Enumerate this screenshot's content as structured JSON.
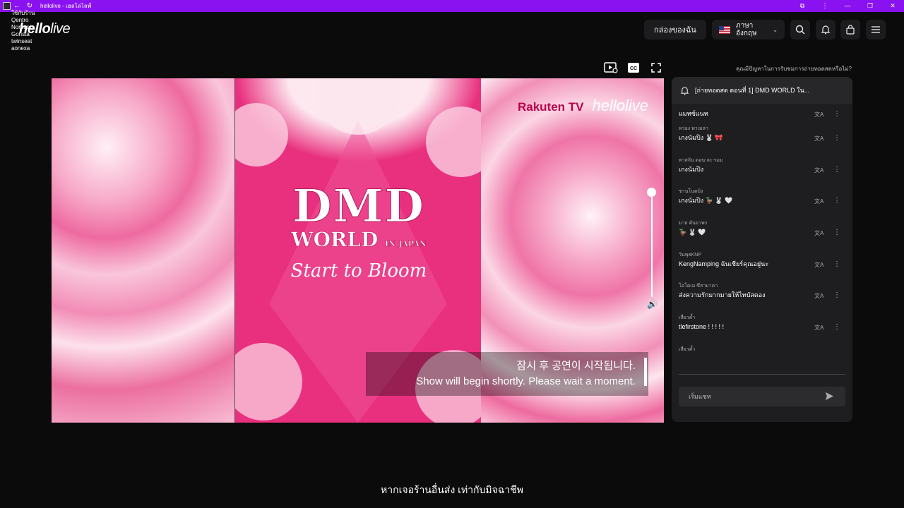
{
  "window": {
    "title": "hellolive - เฮลโลไลฟ์",
    "controls": [
      "←",
      "↻"
    ],
    "right_controls": [
      "⧉",
      "⋮",
      "—",
      "❐",
      "✕"
    ]
  },
  "overlay_list": [
    "ใช้กับร้าน",
    "Qentro",
    "Norbanta",
    "Gonsta",
    "twinseat",
    "aonexa"
  ],
  "header": {
    "logo_bold": "hello",
    "logo_light": "live",
    "my_box": "กล่องของฉัน",
    "language_line1": "ภาษา",
    "language_line2": "อังกฤษ"
  },
  "video_toolbar": {
    "trouble_text": "คุณมีปัญหาในการรับชมการถ่ายทอดสดหรือไม่?"
  },
  "video": {
    "title": "DMD",
    "world": "WORLD",
    "in_japan": "IN JAPAN",
    "subtitle": "Start to Bloom",
    "brand_1": "Rakuten TV",
    "brand_2": "hellolive",
    "notice_ko": "잠시 후 공연이 시작됩니다.",
    "notice_en": "Show will begin shortly. Please wait a moment.",
    "volume_fraction": 1.0
  },
  "chat": {
    "title": "[ถ่ายทอดสด ตอนที่ 1] DMD WORLD ใน...",
    "messages": [
      {
        "user": "",
        "text": "แมทซ์แนท"
      },
      {
        "user": "หว่อง พาเมล่า",
        "text": "เกงนัมปิง 🐰 🎀"
      },
      {
        "user": "ทาสจัน ดอน-ละ-รอม",
        "text": "เกงนัมปิง"
      },
      {
        "user": "ชานโนดมิง",
        "text": "เกงนัมปิง 🦆 🐰 🤍"
      },
      {
        "user": "มาย ดันยาพร",
        "text": "🦆 🐰 🤍"
      },
      {
        "user": "วันพุธKNP",
        "text": "KengNamping ฉันเชียร์คุณอยู่นะ"
      },
      {
        "user": "โอโตเม ซึสามาดา",
        "text": "ส่งความรักมากมายให้ไทบัสดอง"
      },
      {
        "user": "เสี่ยวค้ำ",
        "text": "tlefirstone ! ! ! ! !"
      },
      {
        "user": "เสี่ยวค้ำ",
        "text": ""
      }
    ],
    "input_placeholder": "เริ่มแชท"
  },
  "caption": "หากเจอร้านอื่นส่ง เท่ากับมิจฉาชีพ",
  "colors": {
    "titlebar": "#8a12f0",
    "page_bg": "#0b0b0c",
    "chat_bg": "#1e1e20",
    "accent_pink": "#e9307e"
  }
}
